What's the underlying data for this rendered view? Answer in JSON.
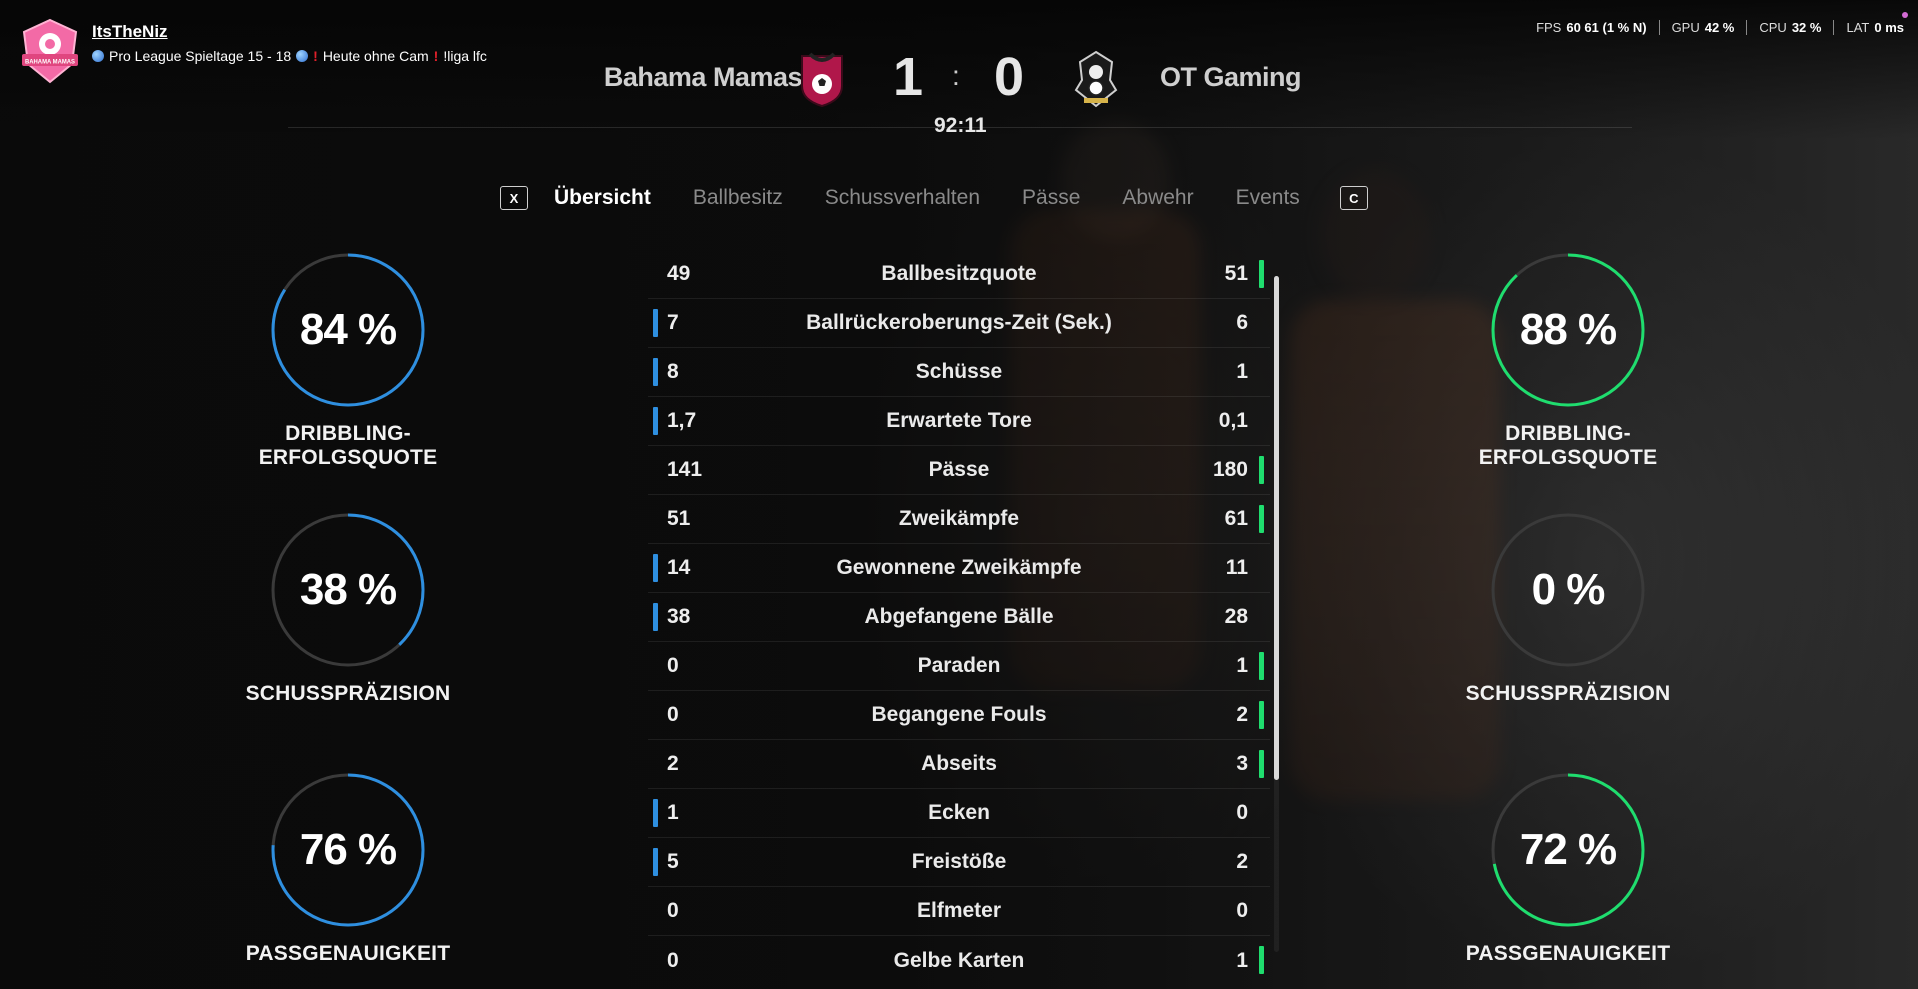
{
  "streamer": {
    "name": "ItsTheNiz",
    "logo_text": "BAHAMA MAMAS",
    "tagline_part1": "Pro League Spieltage 15 - 18",
    "tagline_part2": "Heute ohne Cam",
    "tagline_part3": "!liga lfc"
  },
  "perf": {
    "fps_label": "FPS",
    "fps_value": "60 61 (1 % N)",
    "gpu_label": "GPU",
    "gpu_value": "42 %",
    "cpu_label": "CPU",
    "cpu_value": "32 %",
    "lat_label": "LAT",
    "lat_value": "0 ms"
  },
  "match": {
    "home_team": "Bahama Mamas",
    "away_team": "OT Gaming",
    "home_score": "1",
    "away_score": "0",
    "separator": ":",
    "clock": "92:11"
  },
  "tabs": {
    "prev_key": "X",
    "next_key": "C",
    "items": [
      {
        "label": "Übersicht",
        "active": true
      },
      {
        "label": "Ballbesitz",
        "active": false
      },
      {
        "label": "Schussverhalten",
        "active": false
      },
      {
        "label": "Pässe",
        "active": false
      },
      {
        "label": "Abwehr",
        "active": false
      },
      {
        "label": "Events",
        "active": false
      }
    ]
  },
  "left_circles": [
    {
      "value": "84 %",
      "fraction": 0.84,
      "label": "DRIBBLING-ERFOLGSQUOTE"
    },
    {
      "value": "38 %",
      "fraction": 0.38,
      "label": "SCHUSSPRÄZISION"
    },
    {
      "value": "76 %",
      "fraction": 0.76,
      "label": "PASSGENAUIGKEIT"
    }
  ],
  "right_circles": [
    {
      "value": "88 %",
      "fraction": 0.88,
      "label": "DRIBBLING-ERFOLGSQUOTE"
    },
    {
      "value": "0 %",
      "fraction": 0.0,
      "label": "SCHUSSPRÄZISION"
    },
    {
      "value": "72 %",
      "fraction": 0.72,
      "label": "PASSGENAUIGKEIT"
    }
  ],
  "colors": {
    "home_accent": "#2e8fe0",
    "away_accent": "#1fdd6e"
  },
  "stats": [
    {
      "home": "49",
      "label": "Ballbesitzquote",
      "away": "51",
      "leader": "away"
    },
    {
      "home": "7",
      "label": "Ballrückeroberungs-Zeit (Sek.)",
      "away": "6",
      "leader": "home"
    },
    {
      "home": "8",
      "label": "Schüsse",
      "away": "1",
      "leader": "home"
    },
    {
      "home": "1,7",
      "label": "Erwartete Tore",
      "away": "0,1",
      "leader": "home"
    },
    {
      "home": "141",
      "label": "Pässe",
      "away": "180",
      "leader": "away"
    },
    {
      "home": "51",
      "label": "Zweikämpfe",
      "away": "61",
      "leader": "away"
    },
    {
      "home": "14",
      "label": "Gewonnene Zweikämpfe",
      "away": "11",
      "leader": "home"
    },
    {
      "home": "38",
      "label": "Abgefangene Bälle",
      "away": "28",
      "leader": "home"
    },
    {
      "home": "0",
      "label": "Paraden",
      "away": "1",
      "leader": "away"
    },
    {
      "home": "0",
      "label": "Begangene Fouls",
      "away": "2",
      "leader": "away"
    },
    {
      "home": "2",
      "label": "Abseits",
      "away": "3",
      "leader": "away"
    },
    {
      "home": "1",
      "label": "Ecken",
      "away": "0",
      "leader": "home"
    },
    {
      "home": "5",
      "label": "Freistöße",
      "away": "2",
      "leader": "home"
    },
    {
      "home": "0",
      "label": "Elfmeter",
      "away": "0",
      "leader": "none"
    },
    {
      "home": "0",
      "label": "Gelbe Karten",
      "away": "1",
      "leader": "away"
    }
  ]
}
